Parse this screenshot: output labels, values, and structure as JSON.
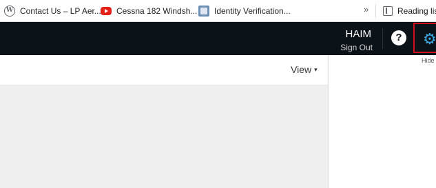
{
  "bookmarks": [
    {
      "icon": "wordpress-icon",
      "label": "Contact Us – LP Aer..."
    },
    {
      "icon": "youtube-icon",
      "label": "Cessna 182 Windsh..."
    },
    {
      "icon": "id-card-icon",
      "label": "Identity Verification..."
    }
  ],
  "bookmarks_overflow": "»",
  "reading_list": {
    "icon": "reading-list-icon",
    "label": "Reading list"
  },
  "header": {
    "user_name": "HAIM",
    "sign_out": "Sign Out",
    "help_symbol": "?",
    "settings_icon": "gear-icon",
    "highlight_color": "#d10f1f",
    "accent_color": "#3ea8e0"
  },
  "toolbar": {
    "view_label": "View",
    "view_caret": "▾"
  },
  "right_panel": {
    "hide_label": "Hide ..."
  }
}
